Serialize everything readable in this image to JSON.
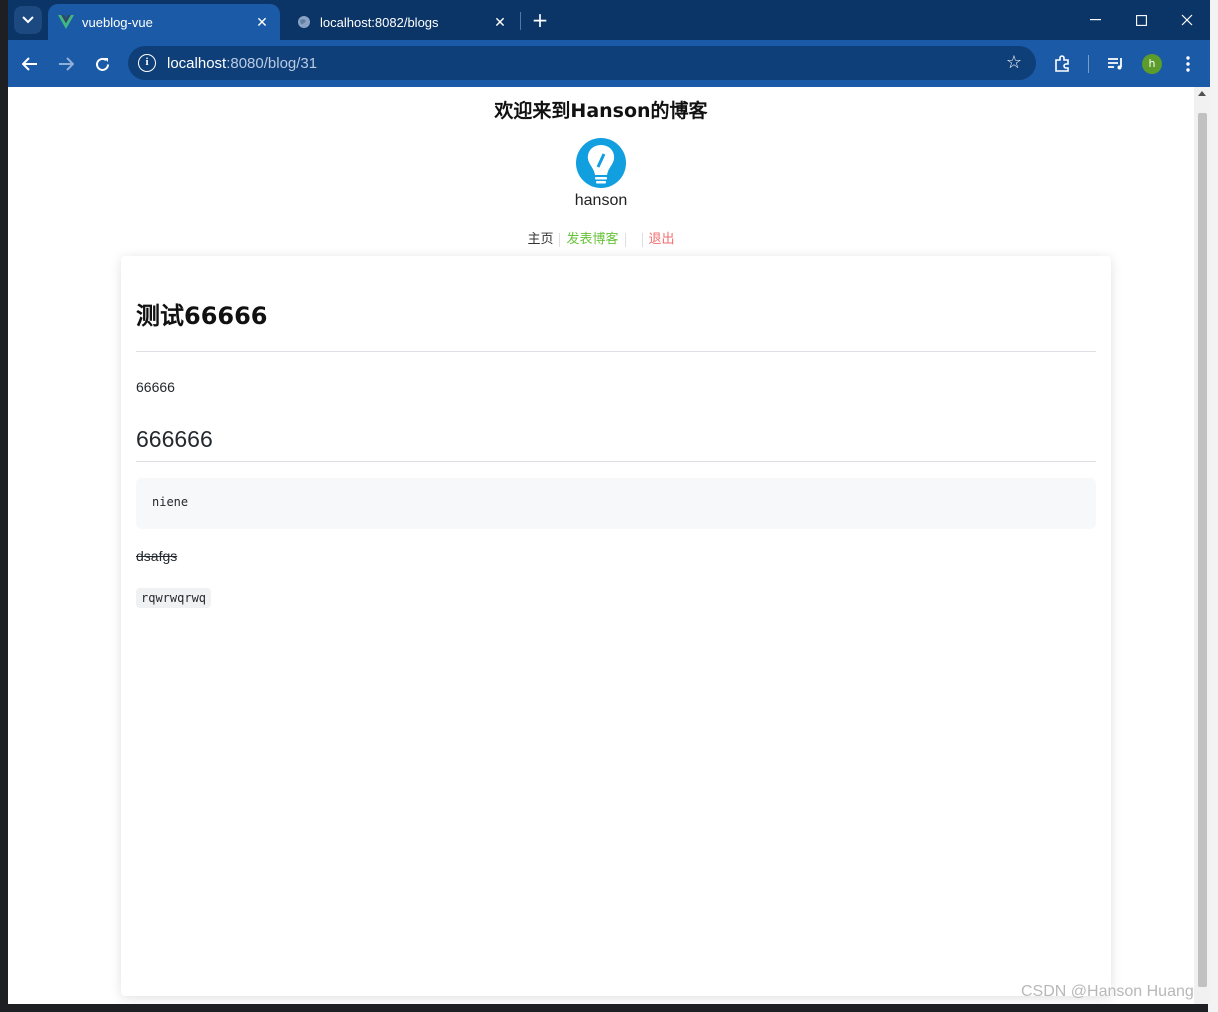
{
  "browser": {
    "tabs": [
      {
        "title": "vueblog-vue",
        "active": true,
        "favicon": "vue-logo-icon"
      },
      {
        "title": "localhost:8082/blogs",
        "active": false,
        "favicon": "globe-icon"
      }
    ],
    "address": {
      "host": "localhost",
      "path": ":8080/blog/31"
    },
    "profile_initial": "h",
    "colors": {
      "tabstrip": "#0b3566",
      "toolbar": "#1b5aa6"
    }
  },
  "site": {
    "title": "欢迎来到Hanson的博客",
    "username": "hanson",
    "nav": {
      "home": "主页",
      "publish": "发表博客",
      "logout": "退出"
    }
  },
  "post": {
    "title": "测试66666",
    "paragraph": "66666",
    "heading2": "666666",
    "code_block": "niene",
    "strikethrough": "dsafgs",
    "inline_code": "rqwrwqrwq"
  },
  "watermark": "CSDN @Hanson Huang"
}
